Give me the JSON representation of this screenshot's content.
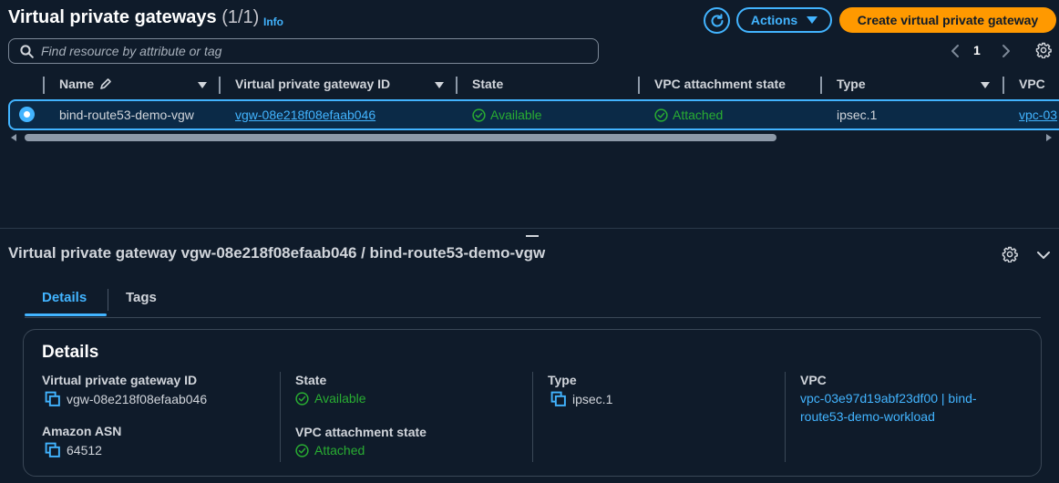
{
  "header": {
    "title": "Virtual private gateways",
    "count": "(1/1)",
    "info": "Info",
    "actions_label": "Actions",
    "create_label": "Create virtual private gateway"
  },
  "search": {
    "placeholder": "Find resource by attribute or tag"
  },
  "pagination": {
    "page": "1"
  },
  "table": {
    "columns": [
      "Name",
      "Virtual private gateway ID",
      "State",
      "VPC attachment state",
      "Type",
      "VPC"
    ],
    "rows": [
      {
        "name": "bind-route53-demo-vgw",
        "id": "vgw-08e218f08efaab046",
        "state": "Available",
        "attachment": "Attached",
        "type": "ipsec.1",
        "vpc": "vpc-03"
      }
    ]
  },
  "detail": {
    "title": "Virtual private gateway vgw-08e218f08efaab046 / bind-route53-demo-vgw",
    "tabs": [
      "Details",
      "Tags"
    ],
    "card_title": "Details",
    "fields": {
      "id_label": "Virtual private gateway ID",
      "id_value": "vgw-08e218f08efaab046",
      "asn_label": "Amazon ASN",
      "asn_value": "64512",
      "state_label": "State",
      "state_value": "Available",
      "attach_label": "VPC attachment state",
      "attach_value": "Attached",
      "type_label": "Type",
      "type_value": "ipsec.1",
      "vpc_label": "VPC",
      "vpc_value_line1": "vpc-03e97d19abf23df00 | bind-",
      "vpc_value_line2": "route53-demo-workload"
    }
  },
  "colors": {
    "background": "#0f1b2a",
    "accent": "#42b4ff",
    "primary_button": "#ff9900",
    "success": "#29ad32"
  }
}
